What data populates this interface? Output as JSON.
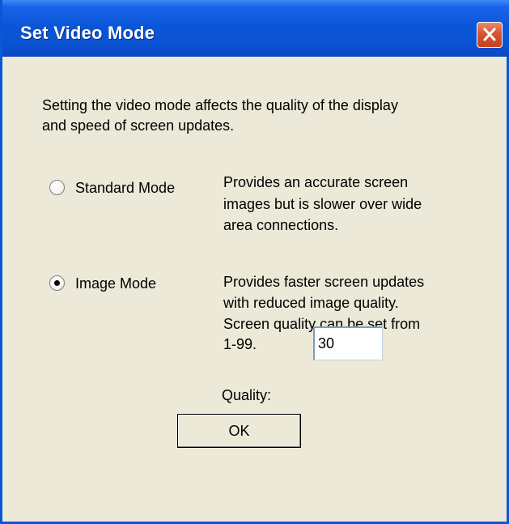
{
  "window": {
    "title": "Set Video Mode",
    "close_icon": "close-icon"
  },
  "intro": {
    "line1": "Setting the video mode affects  the quality of the display",
    "line2": "and speed of screen updates."
  },
  "modes": [
    {
      "label": "Standard Mode",
      "selected": false,
      "description": [
        "Provides an accurate screen",
        "images but is slower over wide",
        "area connections."
      ]
    },
    {
      "label": "Image Mode",
      "selected": true,
      "description": [
        "Provides faster screen updates",
        "with reduced image quality.",
        "Screen quality can be set from",
        "1-99."
      ]
    }
  ],
  "quality": {
    "label": "Quality:",
    "value": "30"
  },
  "ok_button": {
    "label": "OK"
  },
  "colors": {
    "titlebar": "#0a56d8",
    "window_bg": "#ece9d8",
    "close_button": "#d9532f"
  }
}
